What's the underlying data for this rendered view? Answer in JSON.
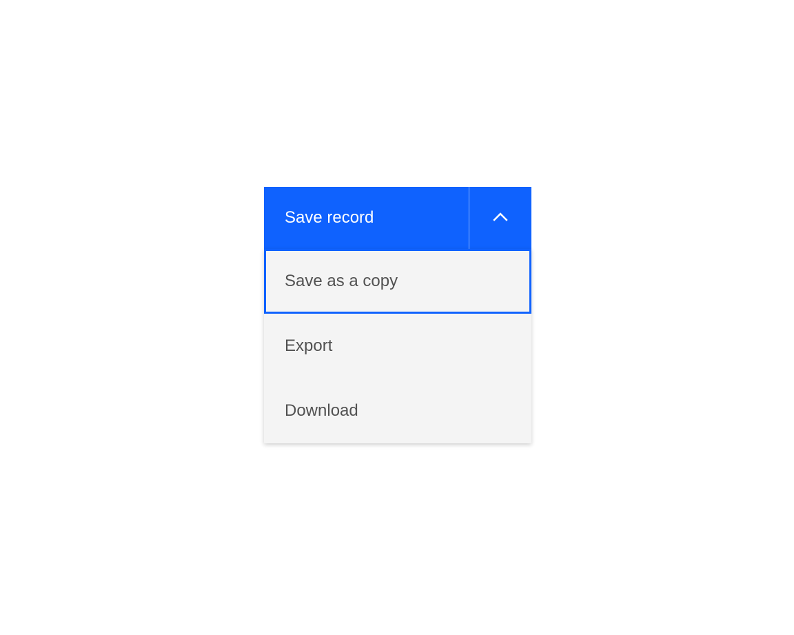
{
  "splitButton": {
    "primaryLabel": "Save record",
    "menu": {
      "items": [
        {
          "label": "Save as a copy"
        },
        {
          "label": "Export"
        },
        {
          "label": "Download"
        }
      ]
    }
  }
}
